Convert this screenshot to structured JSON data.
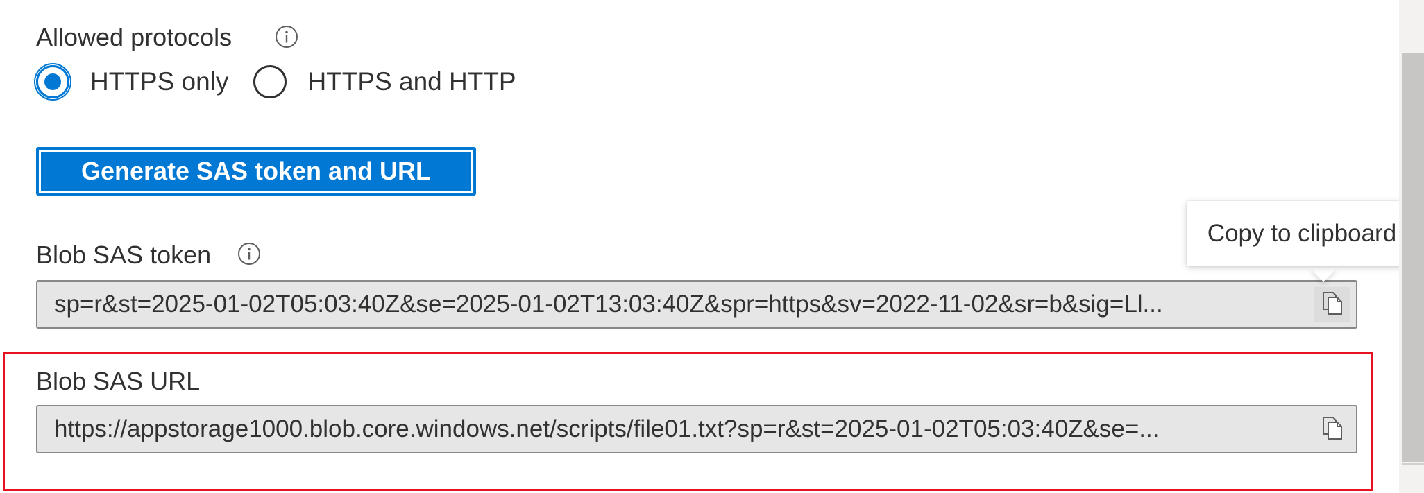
{
  "protocols": {
    "label": "Allowed protocols",
    "options": [
      {
        "label": "HTTPS only",
        "selected": true
      },
      {
        "label": "HTTPS and HTTP",
        "selected": false
      }
    ]
  },
  "generate_button": {
    "label": "Generate SAS token and URL"
  },
  "sas_token": {
    "label": "Blob SAS token",
    "value": "sp=r&st=2025-01-02T05:03:40Z&se=2025-01-02T13:03:40Z&spr=https&sv=2022-11-02&sr=b&sig=Ll..."
  },
  "sas_url": {
    "label": "Blob SAS URL",
    "value": "https://appstorage1000.blob.core.windows.net/scripts/file01.txt?sp=r&st=2025-01-02T05:03:40Z&se=..."
  },
  "tooltip": {
    "text": "Copy to clipboard"
  },
  "icons": {
    "info": "info-icon",
    "copy": "copy-icon"
  },
  "colors": {
    "accent": "#0078d4",
    "highlight": "#e81123",
    "field_background": "#e6e6e6",
    "text": "#323130"
  }
}
